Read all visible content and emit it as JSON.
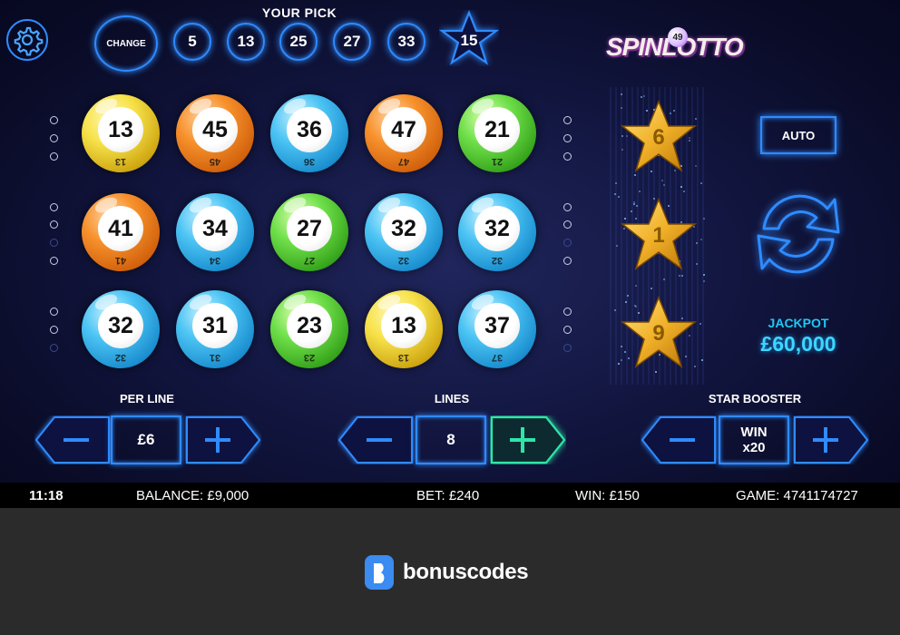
{
  "top": {
    "your_pick_label": "YOUR PICK",
    "change_label": "CHANGE",
    "picks": [
      "5",
      "13",
      "25",
      "27",
      "33"
    ],
    "star_pick": "15",
    "settings_icon": "gear-icon"
  },
  "logo": {
    "text": "SPINLOTTO",
    "ball_number": "49"
  },
  "grid": {
    "rows": [
      [
        {
          "n": "13",
          "color": "yellow"
        },
        {
          "n": "45",
          "color": "orange"
        },
        {
          "n": "36",
          "color": "blue"
        },
        {
          "n": "47",
          "color": "orange"
        },
        {
          "n": "21",
          "color": "green"
        }
      ],
      [
        {
          "n": "41",
          "color": "orange"
        },
        {
          "n": "34",
          "color": "blue"
        },
        {
          "n": "27",
          "color": "green"
        },
        {
          "n": "32",
          "color": "blue"
        },
        {
          "n": "32",
          "color": "blue"
        }
      ],
      [
        {
          "n": "32",
          "color": "blue"
        },
        {
          "n": "31",
          "color": "blue"
        },
        {
          "n": "23",
          "color": "green"
        },
        {
          "n": "13",
          "color": "yellow"
        },
        {
          "n": "37",
          "color": "blue"
        }
      ]
    ]
  },
  "star_reel": [
    "6",
    "1",
    "9"
  ],
  "side": {
    "auto_label": "AUTO",
    "spin_icon": "refresh-icon",
    "jackpot_label": "JACKPOT",
    "jackpot_value": "£60,000"
  },
  "controls": {
    "per_line": {
      "label": "PER LINE",
      "value": "£6"
    },
    "lines": {
      "label": "LINES",
      "value": "8"
    },
    "star_booster": {
      "label": "STAR BOOSTER",
      "value_line1": "WIN",
      "value_line2": "x20"
    }
  },
  "status": {
    "time": "11:18",
    "balance": "BALANCE: £9,000",
    "bet": "BET: £240",
    "win": "WIN: £150",
    "game": "GAME: 4741174727"
  },
  "watermark": {
    "text": "bonuscodes"
  },
  "colors": {
    "neon_blue": "#2f8bff",
    "neon_green": "#2ee6a8",
    "jackpot": "#3ad8ff"
  }
}
